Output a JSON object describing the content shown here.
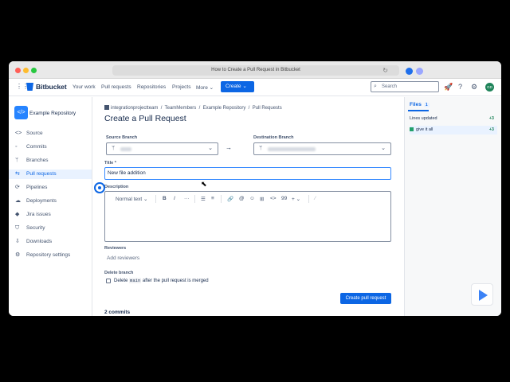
{
  "browser": {
    "url_title": "How to Create a Pull Request in Bitbucket"
  },
  "topnav": {
    "brand": "Bitbucket",
    "links": [
      "Your work",
      "Pull requests",
      "Repositories",
      "Projects",
      "More"
    ],
    "create": "Create",
    "search_placeholder": "Search",
    "avatar_initials": "GD"
  },
  "sidebar": {
    "repo_name": "Example Repository",
    "items": [
      {
        "label": "Source",
        "icon": "code-icon"
      },
      {
        "label": "Commits",
        "icon": "commit-icon"
      },
      {
        "label": "Branches",
        "icon": "branch-icon"
      },
      {
        "label": "Pull requests",
        "icon": "pull-request-icon",
        "active": true
      },
      {
        "label": "Pipelines",
        "icon": "pipeline-icon"
      },
      {
        "label": "Deployments",
        "icon": "deployment-icon"
      },
      {
        "label": "Jira issues",
        "icon": "jira-icon"
      },
      {
        "label": "Security",
        "icon": "shield-icon"
      },
      {
        "label": "Downloads",
        "icon": "download-icon"
      },
      {
        "label": "Repository settings",
        "icon": "gear-icon"
      }
    ]
  },
  "breadcrumb": [
    "integrationprojectteam",
    "TeamMembers",
    "Example Repository",
    "Pull Requests"
  ],
  "page_title": "Create a Pull Request",
  "form": {
    "source_label": "Source Branch",
    "dest_label": "Destination Branch",
    "title_label": "Title *",
    "title_value": "New file addition",
    "description_label": "Description",
    "toolbar": {
      "text_style": "Normal text",
      "bold": "B",
      "italic": "I",
      "more": "···",
      "bullet": "☰",
      "numbered": "≡",
      "link": "🔗",
      "mention": "@",
      "emoji": "☺",
      "table": "⊞",
      "code": "<>",
      "quote": "99",
      "insert": "+"
    },
    "reviewers_label": "Reviewers",
    "reviewers_placeholder": "Add reviewers",
    "delete_branch_label": "Delete branch",
    "delete_branch_prefix": "Delete",
    "delete_branch_code": "main",
    "delete_branch_suffix": "after the pull request is merged",
    "submit": "Create pull request",
    "commits": "2 commits"
  },
  "files_panel": {
    "header": "Files",
    "count": "1",
    "lines_label": "Lines updated",
    "lines_count": "+3",
    "file_name": "give it all",
    "file_count": "+3"
  },
  "colors": {
    "accent": "#0c66e4",
    "added": "#22a06b"
  }
}
